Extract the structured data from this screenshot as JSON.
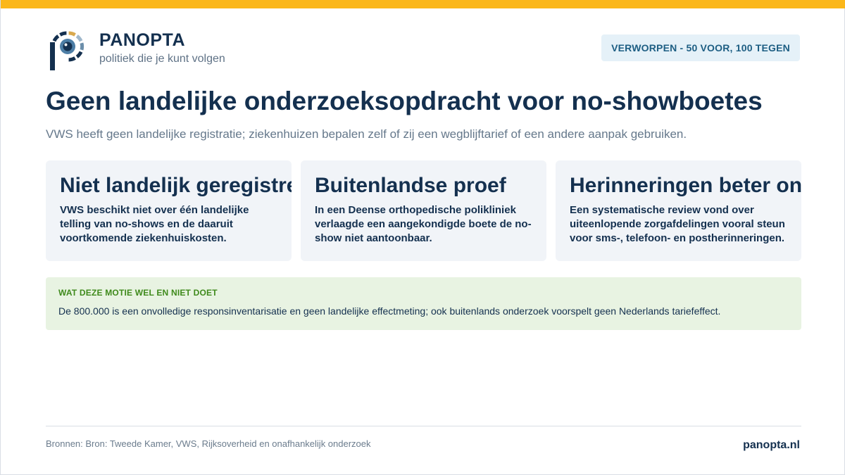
{
  "brand": {
    "name": "PANOPTA",
    "tagline": "politiek die je kunt volgen"
  },
  "status": {
    "label": "VERWORPEN - 50 VOOR, 100 TEGEN"
  },
  "headline": {
    "title": "Geen landelijke onderzoeksopdracht voor no-showboetes",
    "subtitle": "VWS heeft geen landelijke registratie; ziekenhuizen bepalen zelf of zij een wegblijftarief of een andere aanpak gebruiken."
  },
  "cards": [
    {
      "title": "Niet landelijk geregistreerd",
      "body": "VWS beschikt niet over één landelijke telling van no-shows en de daaruit voortkomende ziekenhuiskosten."
    },
    {
      "title": "Buitenlandse proef",
      "body": "In een Deense orthopedische polikliniek verlaagde een aangekondigde boete de no-show niet aantoonbaar."
    },
    {
      "title": "Herinneringen beter onderzocht",
      "body": "Een systematische review vond over uiteenlopende zorgafdelingen vooral steun voor sms-, telefoon- en postherinneringen."
    }
  ],
  "note": {
    "label": "WAT DEZE MOTIE WEL EN NIET DOET",
    "text": "De 800.000 is een onvolledige responsinventarisatie en geen landelijke effectmeting; ook buitenlands onderzoek voorspelt geen Nederlands tariefeffect."
  },
  "footer": {
    "sources": "Bronnen: Bron: Tweede Kamer, VWS, Rijksoverheid en onafhankelijk onderzoek",
    "site": "panopta.nl"
  },
  "colors": {
    "accent_bar": "#fbb71a",
    "navy": "#14304f",
    "status_bg": "#e5f1f8",
    "status_text": "#1d5e83",
    "note_bg": "#e8f3e2",
    "note_label": "#3f8a1c"
  },
  "icons": {
    "logo": "panopta-eye-logo"
  }
}
